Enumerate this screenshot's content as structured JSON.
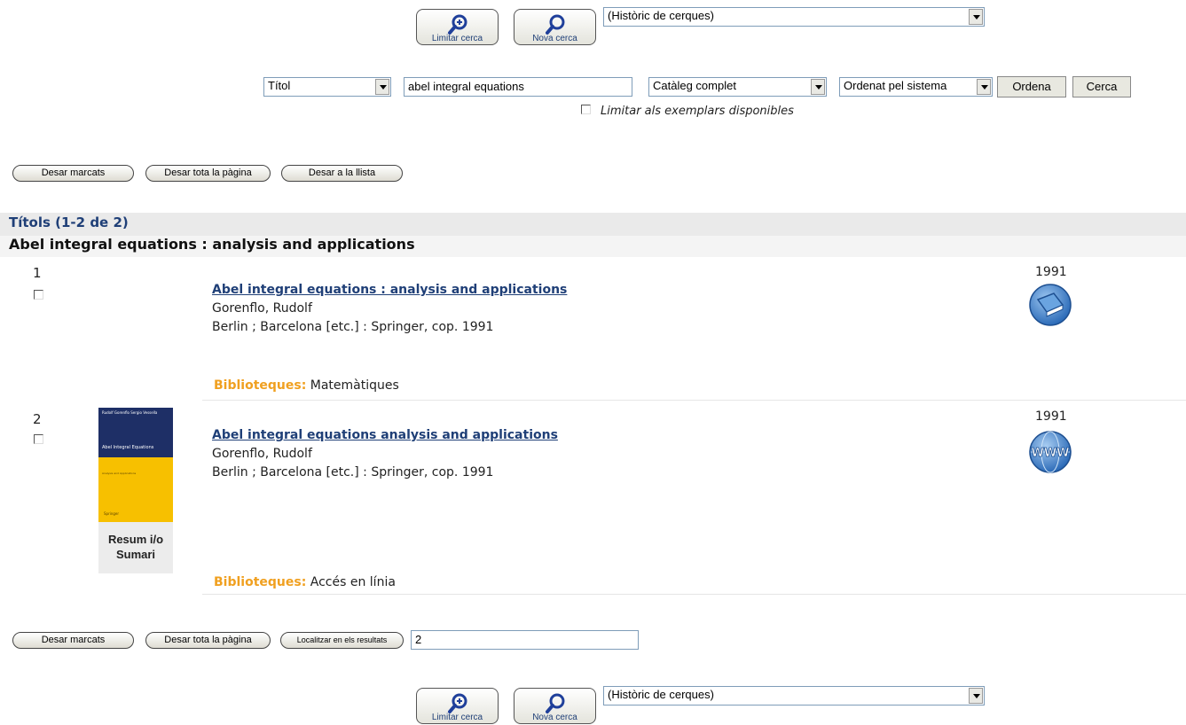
{
  "top_bar": {
    "limit_label": "Limitar cerca",
    "new_label": "Nova cerca",
    "history": "(Històric de cerques)"
  },
  "search": {
    "field": "Títol",
    "query": "abel integral equations",
    "catalog": "Catàleg complet",
    "sort": "Ordenat pel sistema",
    "sort_button": "Ordena",
    "search_button": "Cerca",
    "limit_available": "Limitar als exemplars disponibles"
  },
  "actions_top": {
    "save_marked": "Desar marcats",
    "save_page": "Desar tota la pàgina",
    "save_list": "Desar a la llista"
  },
  "results": {
    "heading": "Títols (1-2 de 2)",
    "group_title": "Abel integral equations : analysis and applications",
    "items": [
      {
        "number": "1",
        "title": "Abel integral equations : analysis and applications",
        "author": "Gorenflo, Rudolf",
        "publisher": "Berlin ; Barcelona [etc.] : Springer, cop. 1991",
        "year": "1991",
        "format_icon": "book-icon",
        "libraries_label": "Biblioteques:",
        "libraries": "Matemàtiques"
      },
      {
        "number": "2",
        "title": "Abel integral equations analysis and applications",
        "author": "Gorenflo, Rudolf",
        "publisher": "Berlin ; Barcelona [etc.] : Springer, cop. 1991",
        "year": "1991",
        "format_icon": "www-globe-icon",
        "summary_label": "Resum i/o Sumari",
        "cover": {
          "authors": "Rudolf Gorenflo Sergio Vessella",
          "title": "Abel Integral Equations",
          "subtitle": "Analysis and Applications",
          "publisher": "Springer"
        },
        "libraries_label": "Biblioteques:",
        "libraries": "Accés en línia"
      }
    ]
  },
  "actions_bottom": {
    "save_marked": "Desar marcats",
    "save_page": "Desar tota la pàgina",
    "locate": "Localitzar en els resultats",
    "locate_value": "2"
  },
  "colors": {
    "link": "#1f3f77",
    "library_label": "#f0a020",
    "band": "#eaeaea"
  }
}
